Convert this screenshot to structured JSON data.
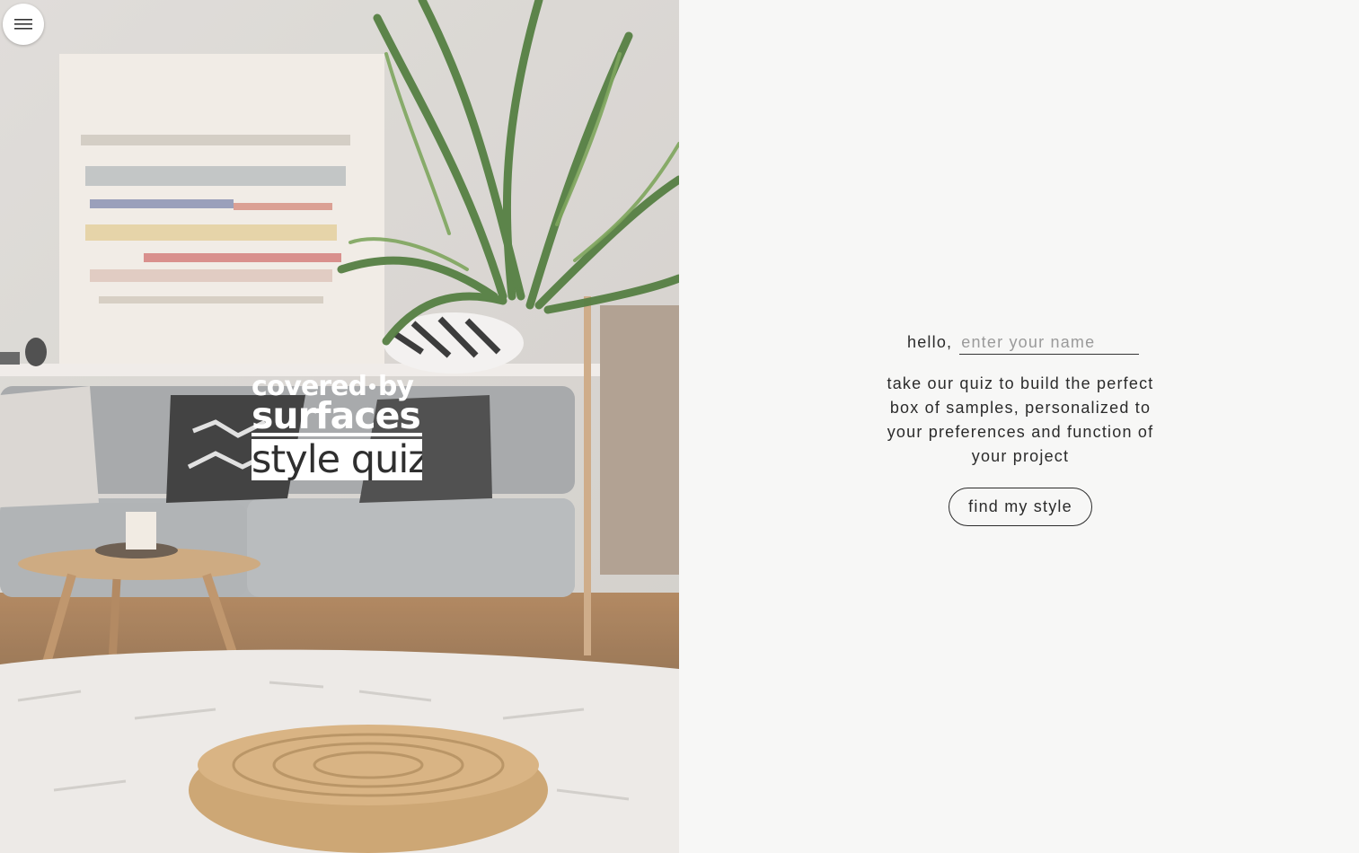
{
  "menu": {
    "icon": "hamburger-menu-icon"
  },
  "logo": {
    "line1_a": "covered",
    "line1_b": "by",
    "line2": "surfaces",
    "line3": "style quiz"
  },
  "hero": {
    "image": "living-room-photo"
  },
  "form": {
    "hello_label": "hello,",
    "name_placeholder": "enter your name",
    "name_value": ""
  },
  "intro": {
    "text": "take our quiz to build the perfect box of samples, personalized to your preferences and function of your project"
  },
  "cta": {
    "label": "find my style"
  },
  "colors": {
    "panel_bg": "#f7f7f6",
    "text": "#2b2b2b",
    "placeholder": "#9a9a9a"
  }
}
